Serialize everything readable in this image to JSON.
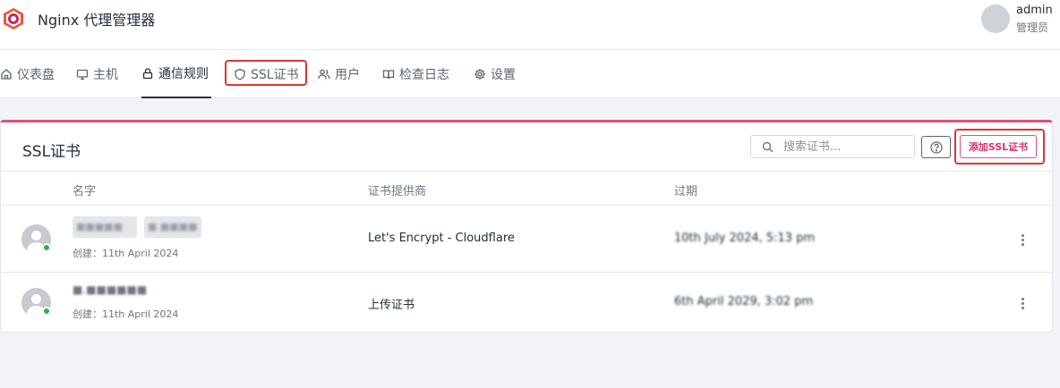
{
  "header": {
    "app_title": "Nginx 代理管理器",
    "user_name": "admin",
    "user_role": "管理员"
  },
  "nav": {
    "items": [
      {
        "label": "仪表盘",
        "icon": "home-icon"
      },
      {
        "label": "主机",
        "icon": "monitor-icon"
      },
      {
        "label": "通信规则",
        "icon": "lock-icon",
        "active": true
      },
      {
        "label": "SSL证书",
        "icon": "shield-icon",
        "highlighted": true
      },
      {
        "label": "用户",
        "icon": "users-icon"
      },
      {
        "label": "检查日志",
        "icon": "book-icon"
      },
      {
        "label": "设置",
        "icon": "gear-icon"
      }
    ]
  },
  "card": {
    "title": "SSL证书",
    "search_placeholder": "搜索证书...",
    "help_label": "?",
    "add_button": "添加SSL证书",
    "columns": [
      "名字",
      "证书提供商",
      "过期"
    ],
    "rows": [
      {
        "name_parts": [
          "■■■■■",
          "■.■■■■"
        ],
        "created": "创建：11th April 2024",
        "provider": "Let's Encrypt - Cloudflare",
        "expiry": "10th July 2024, 5:13 pm",
        "online": true
      },
      {
        "name": "■.■■■■■■",
        "created": "创建：11th April 2024",
        "provider": "上传证书",
        "expiry": "6th April 2029, 3:02 pm",
        "online": true
      }
    ]
  },
  "colors": {
    "accent": "#e0527a",
    "highlight_box": "#e03434",
    "online": "#2fb344"
  }
}
